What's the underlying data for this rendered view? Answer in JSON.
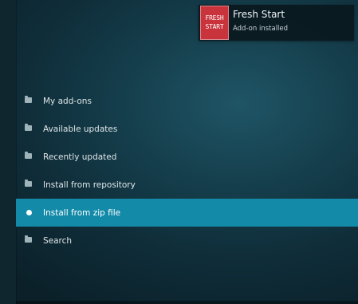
{
  "notification": {
    "title": "Fresh Start",
    "subtitle": "Add-on installed",
    "thumbnail_lines": [
      "FRESH",
      "START"
    ],
    "thumbnail_color": "#c8333c"
  },
  "menu": {
    "items": [
      {
        "label": "My add-ons",
        "icon": "folder-icon",
        "active": false
      },
      {
        "label": "Available updates",
        "icon": "folder-icon",
        "active": false
      },
      {
        "label": "Recently updated",
        "icon": "folder-icon",
        "active": false
      },
      {
        "label": "Install from repository",
        "icon": "folder-icon",
        "active": false
      },
      {
        "label": "Install from zip file",
        "icon": "dot-icon",
        "active": true
      },
      {
        "label": "Search",
        "icon": "folder-icon",
        "active": false
      }
    ],
    "highlight_color": "#138aa8"
  }
}
